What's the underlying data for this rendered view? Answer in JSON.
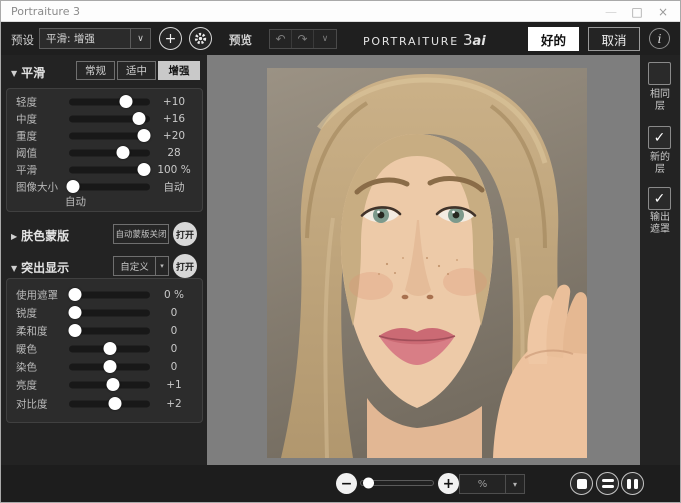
{
  "window": {
    "title": "Portraiture 3",
    "minimize": "—",
    "maximize": "□",
    "close": "×"
  },
  "toolbar": {
    "preset_label": "预设",
    "preset_value": "平滑: 增强",
    "preset_arrow": "∨",
    "add_button": "+",
    "preview_label": "预览",
    "undo": "↶",
    "redo": "↷",
    "history_arrow": "∨",
    "logo_main": "Portraiture",
    "logo_version": "3",
    "logo_suffix": "ai",
    "ok_label": "好的",
    "cancel_label": "取消",
    "info_label": "i"
  },
  "smoothing": {
    "collapse_arrow": "▼",
    "section_title": "平滑",
    "modes": [
      {
        "label": "常规",
        "selected": false
      },
      {
        "label": "适中",
        "selected": false
      },
      {
        "label": "增强",
        "selected": true
      }
    ],
    "sliders": [
      {
        "label": "轻度",
        "value": "+10",
        "pos": "70%"
      },
      {
        "label": "中度",
        "value": "+16",
        "pos": "86%"
      },
      {
        "label": "重度",
        "value": "+20",
        "pos": "92%"
      },
      {
        "label": "阈值",
        "value": "28",
        "pos": "67%"
      },
      {
        "label": "平滑",
        "value": "100 %",
        "pos": "92%"
      },
      {
        "label": "图像大小",
        "value": "自动",
        "pos": "5%",
        "sub_label": "自动"
      }
    ]
  },
  "skin_mask": {
    "collapse_arrow": "▶",
    "section_title": "肤色蒙版",
    "status_text": "自动蒙版关闭",
    "toggle_label": "打开"
  },
  "enhance": {
    "collapse_arrow": "▼",
    "section_title": "突出显示",
    "preset_value": "自定义",
    "dropdown_arrow": "▾",
    "toggle_label": "打开",
    "sliders": [
      {
        "label": "使用遮罩",
        "value": "0 %",
        "pos": "8%"
      },
      {
        "label": "锐度",
        "value": "0",
        "pos": "8%"
      },
      {
        "label": "柔和度",
        "value": "0",
        "pos": "8%"
      },
      {
        "label": "暖色",
        "value": "0",
        "pos": "51%"
      },
      {
        "label": "染色",
        "value": "0",
        "pos": "51%"
      },
      {
        "label": "亮度",
        "value": "+1",
        "pos": "54%"
      },
      {
        "label": "对比度",
        "value": "+2",
        "pos": "57%"
      }
    ]
  },
  "output_panel": {
    "options": [
      {
        "line1": "相同",
        "line2": "层",
        "check": ""
      },
      {
        "line1": "新的",
        "line2": "层",
        "check": "✓"
      },
      {
        "line1": "输出",
        "line2": "遮罩",
        "check": "✓"
      }
    ]
  },
  "bottom_bar": {
    "zoom_out": "−",
    "zoom_in": "+",
    "zoom_value": "%",
    "zoom_dropdown_arrow": "▾"
  },
  "colors": {
    "app_bg": "#232323",
    "panel_bg": "#2c2c2c",
    "canvas_bg": "#7e7e7e",
    "selected_mode_bg": "#c9c9c9",
    "knob": "#ffffff",
    "ok_button_bg": "#ffffff"
  }
}
